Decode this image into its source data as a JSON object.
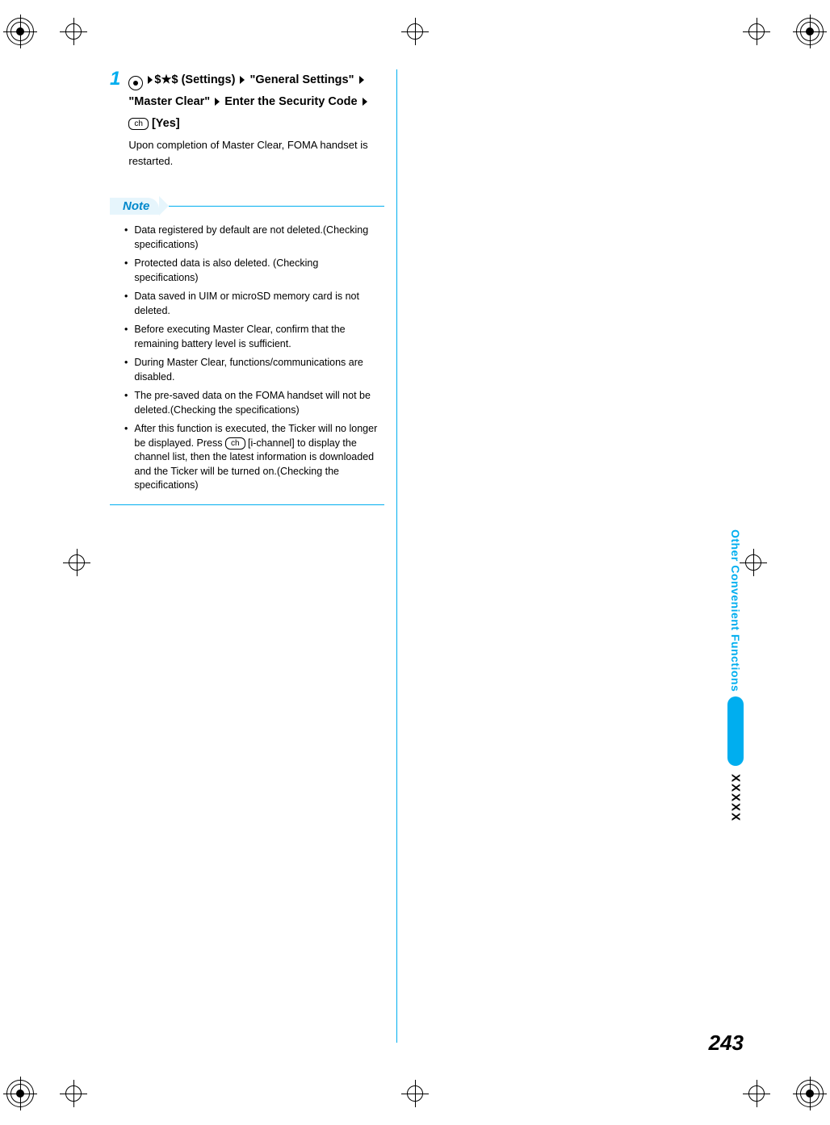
{
  "page_number": "243",
  "side_tab": {
    "label": "Other Convenient Functions",
    "marker": "XXXXX"
  },
  "step": {
    "number": "1",
    "settings_label": "(Settings)",
    "dollars": "$★$",
    "nav_general": "\"General Settings\"",
    "nav_master": "\"Master Clear\"",
    "enter_security": "Enter the Security Code",
    "yes_label": "[Yes]",
    "key_pill": "ch",
    "result": "Upon completion of Master Clear, FOMA handset is restarted."
  },
  "note": {
    "title": "Note",
    "items": [
      "Data registered by default are not deleted.(Checking specifications)",
      "Protected data is also deleted. (Checking specifications)",
      "Data saved in UIM or microSD memory card is not deleted.",
      "Before executing Master Clear, confirm that the remaining battery level is sufficient.",
      "During Master Clear, functions/communications are disabled.",
      "The pre-saved data on the FOMA handset will not be deleted.(Checking the specifications)"
    ],
    "last_item_pre": "After this function is executed, the Ticker will no longer be displayed. Press ",
    "last_item_key": "ch",
    "last_item_post": " [i-channel] to display the channel list, then the latest information is downloaded and the Ticker will be turned on.(Checking the specifications)"
  }
}
